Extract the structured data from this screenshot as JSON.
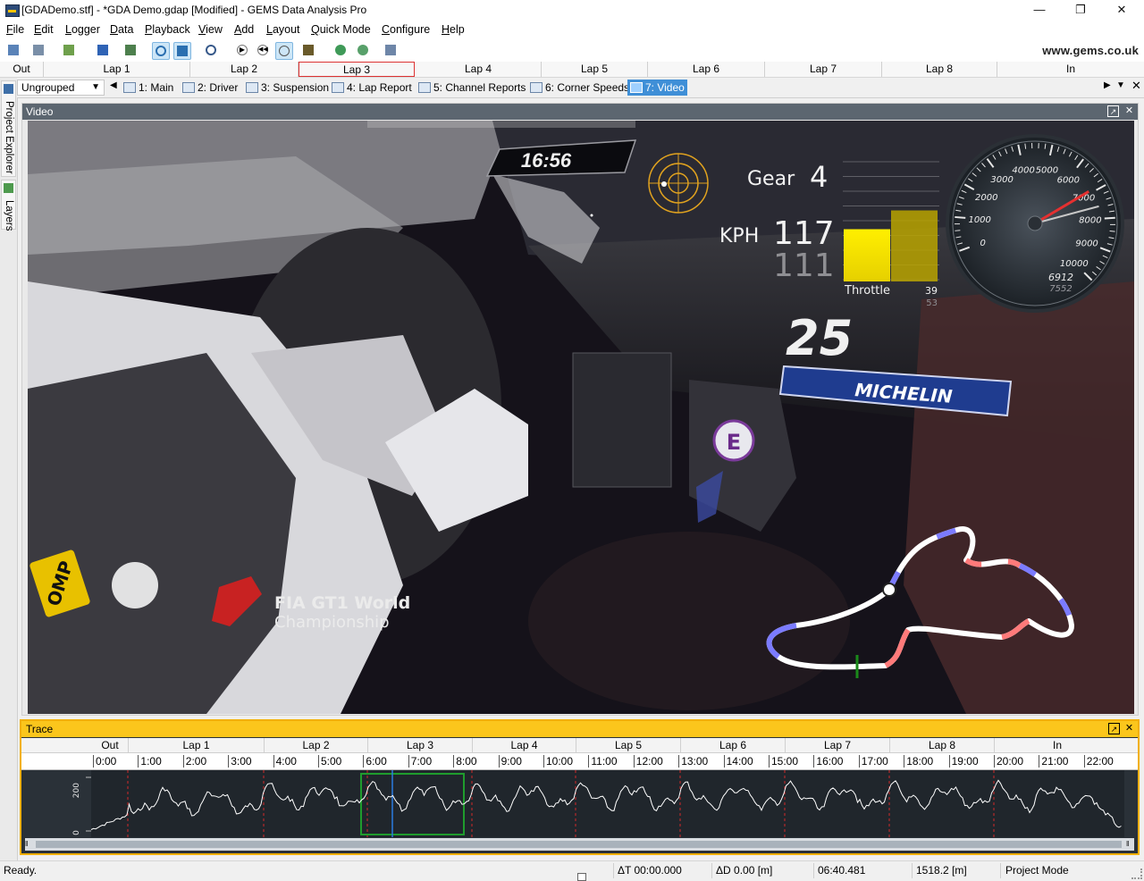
{
  "window": {
    "title": "[GDADemo.stf] - *GDA Demo.gdap [Modified] - GEMS Data Analysis Pro",
    "minimize_glyph": "—",
    "maximize_glyph": "❐",
    "close_glyph": "✕"
  },
  "menu": [
    {
      "label": "File",
      "u": "F",
      "rest": "ile"
    },
    {
      "label": "Edit",
      "u": "E",
      "rest": "dit"
    },
    {
      "label": "Logger",
      "u": "L",
      "rest": "ogger"
    },
    {
      "label": "Data",
      "u": "D",
      "rest": "ata"
    },
    {
      "label": "Playback",
      "u": "P",
      "rest": "layback"
    },
    {
      "label": "View",
      "u": "V",
      "rest": "iew"
    },
    {
      "label": "Add",
      "u": "A",
      "rest": "dd"
    },
    {
      "label": "Layout",
      "u": "L",
      "rest": "ayout"
    },
    {
      "label": "Quick Mode",
      "u": "Q",
      "rest": "uick Mode"
    },
    {
      "label": "Configure",
      "u": "C",
      "rest": "onfigure"
    },
    {
      "label": "Help",
      "u": "H",
      "rest": "elp"
    }
  ],
  "toolbar": {
    "url": "www.gems.co.uk"
  },
  "laps": [
    "Out",
    "Lap 1",
    "Lap 2",
    "Lap 3",
    "Lap 4",
    "Lap 5",
    "Lap 6",
    "Lap 7",
    "Lap 8",
    "In"
  ],
  "tabs": {
    "group": "Ungrouped",
    "items": [
      "1: Main",
      "2: Driver",
      "3: Suspension",
      "4: Lap Report",
      "5: Channel Reports",
      "6: Corner Speeds",
      "7: Video"
    ],
    "active_index": 6
  },
  "sidebar": {
    "project_explorer": "Project Explorer",
    "layers": "Layers"
  },
  "video": {
    "panel_title": "Video",
    "clock": "16:56",
    "gear_label": "Gear",
    "gear": "4",
    "speed_label": "KPH",
    "speed": "117",
    "speed_ref": "111",
    "throttle_label": "Throttle",
    "throttle_value": 39,
    "throttle_ref": 53,
    "rpm": "6912",
    "rpm_ref": "7552",
    "rpm_ticks": [
      "0",
      "1000",
      "2000",
      "3000",
      "4000",
      "5000",
      "6000",
      "7000",
      "8000",
      "9000",
      "10000"
    ],
    "car_number": "25",
    "sponsor": "MICHELIN",
    "series_logo_line1": "FIA GT1 World",
    "series_logo_line2": "Championship",
    "glove_brand": "OMP",
    "door_badge": "E",
    "colors": {
      "hud_yellow": "#f7e600",
      "ring_orange": "#e0a21f",
      "needle": "#e53030",
      "track_white": "#ffffff",
      "track_red": "#ff7a7a",
      "track_blue": "#7b7bff",
      "start_green": "#1a8a1a"
    }
  },
  "trace": {
    "panel_title": "Trace",
    "times": [
      "0:00",
      "1:00",
      "2:00",
      "3:00",
      "4:00",
      "5:00",
      "6:00",
      "7:00",
      "8:00",
      "9:00",
      "10:00",
      "11:00",
      "12:00",
      "13:00",
      "14:00",
      "15:00",
      "16:00",
      "17:00",
      "18:00",
      "19:00",
      "20:00",
      "21:00",
      "22:00"
    ],
    "y_ticks": [
      "200",
      "0"
    ],
    "colors": {
      "border": "#f2b000",
      "header": "#fbc61c",
      "lap_divider": "#d22a2a",
      "selection": "#1f9c2d",
      "cursor": "#2a7be0"
    }
  },
  "status": {
    "ready": "Ready.",
    "delta_t": "ΔT 00:00.000",
    "delta_d": "ΔD 0.00 [m]",
    "time": "06:40.481",
    "distance": "1518.2 [m]",
    "mode": "Project Mode"
  }
}
